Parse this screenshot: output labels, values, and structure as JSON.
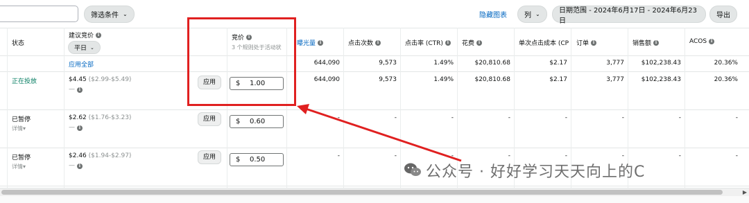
{
  "toolbar": {
    "filter_label": "筛选条件",
    "hide_chart": "隐藏图表",
    "columns_label": "列",
    "date_range": "日期范围 - 2024年6月17日 - 2024年6月23日",
    "export_label": "导出"
  },
  "table": {
    "headers": {
      "status": "状态",
      "suggested_bid": "建议竞价",
      "period": "平日",
      "bid": "竞价",
      "bid_sub": "3 个规则处于活动状",
      "impressions": "曝光量",
      "clicks": "点击次数",
      "ctr": "点击率 (CTR)",
      "spend": "花费",
      "cpc": "单次点击成本 (CPC)",
      "orders": "订单",
      "sales": "销售额",
      "acos": "ACOS"
    },
    "apply_all": "应用全部",
    "totals": {
      "impressions": "644,090",
      "clicks": "9,573",
      "ctr": "1.49%",
      "spend": "$20,810.68",
      "cpc": "$2.17",
      "orders": "3,777",
      "sales": "$102,238.43",
      "acos": "20.36%"
    },
    "rows": [
      {
        "status": "正在投放",
        "detail": "",
        "suggested": "$4.45",
        "range": "($2.99-$5.49)",
        "dash": "—",
        "apply": "应用",
        "currency": "$",
        "bid": "1.00",
        "impressions": "644,090",
        "clicks": "9,573",
        "ctr": "1.49%",
        "spend": "$20,810.68",
        "cpc": "$2.17",
        "orders": "3,777",
        "sales": "$102,238.43",
        "acos": "20.36%"
      },
      {
        "status": "已暂停",
        "detail": "详情",
        "suggested": "$2.62",
        "range": "($1.76-$3.23)",
        "dash": "—",
        "apply": "应用",
        "currency": "$",
        "bid": "0.60",
        "impressions": "-",
        "clicks": "-",
        "ctr": "-",
        "spend": "-",
        "cpc": "-",
        "orders": "-",
        "sales": "-",
        "acos": "-"
      },
      {
        "status": "已暂停",
        "detail": "详情",
        "suggested": "$2.46",
        "range": "($1.94-$2.97)",
        "dash": "—",
        "apply": "应用",
        "currency": "$",
        "bid": "0.50",
        "impressions": "-",
        "clicks": "-",
        "ctr": "-",
        "spend": "-",
        "cpc": "-",
        "orders": "-",
        "sales": "-",
        "acos": "-"
      }
    ]
  },
  "watermark": "公众号 · 好好学习天天向上的C",
  "colors": {
    "accent_link": "#0066c0",
    "status_active": "#067d62",
    "annotation_red": "#e02020"
  }
}
